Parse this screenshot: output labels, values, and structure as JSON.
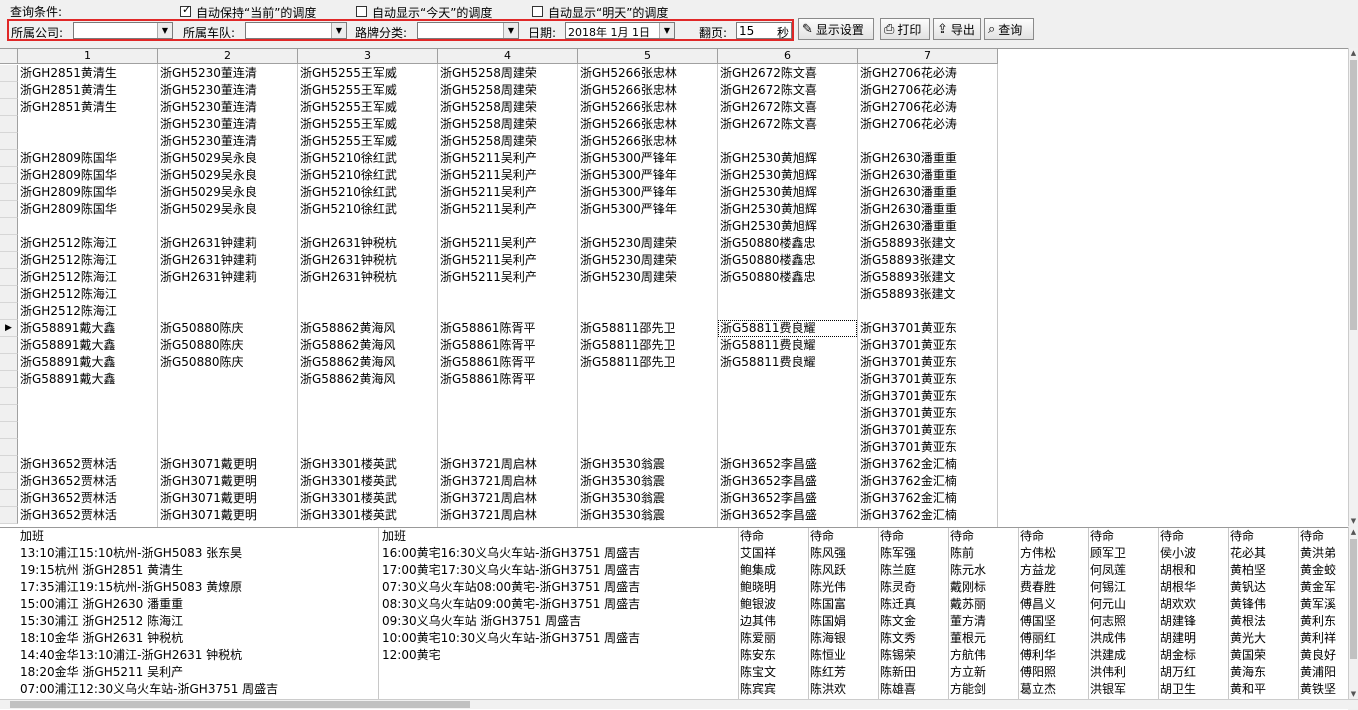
{
  "colors": {
    "highlight_border": "#e02828"
  },
  "topbar": {
    "label": "查询条件:",
    "checks": [
      {
        "label": "自动保持“当前”的调度",
        "checked": true
      },
      {
        "label": "自动显示“今天”的调度",
        "checked": false
      },
      {
        "label": "自动显示“明天”的调度",
        "checked": false
      }
    ]
  },
  "filters": {
    "company_label": "所属公司:",
    "company_value": "",
    "fleet_label": "所属车队:",
    "fleet_value": "",
    "route_label": "路牌分类:",
    "route_value": "",
    "date_label": "日期:",
    "date_value": "2018年  1月  1日",
    "page_label": "翻页:",
    "page_value": "15",
    "page_unit": "秒"
  },
  "toolbar": {
    "display_settings": "显示设置",
    "print": "打印",
    "export": "导出",
    "query": "查询",
    "icons": [
      "pencil-icon",
      "printer-icon",
      "export-icon",
      "magnifier-icon"
    ]
  },
  "grid": {
    "columns": [
      "1",
      "2",
      "3",
      "4",
      "5",
      "6",
      "7"
    ],
    "current_row": 15,
    "rows": [
      [
        "浙GH2851黄清生",
        "浙GH5230董连清",
        "浙GH5255王军威",
        "浙GH5258周建荣",
        "浙GH5266张忠林",
        "浙GH2672陈文喜",
        "浙GH2706花必涛"
      ],
      [
        "浙GH2851黄清生",
        "浙GH5230董连清",
        "浙GH5255王军威",
        "浙GH5258周建荣",
        "浙GH5266张忠林",
        "浙GH2672陈文喜",
        "浙GH2706花必涛"
      ],
      [
        "浙GH2851黄清生",
        "浙GH5230董连清",
        "浙GH5255王军威",
        "浙GH5258周建荣",
        "浙GH5266张忠林",
        "浙GH2672陈文喜",
        "浙GH2706花必涛"
      ],
      [
        "",
        "浙GH5230董连清",
        "浙GH5255王军威",
        "浙GH5258周建荣",
        "浙GH5266张忠林",
        "浙GH2672陈文喜",
        "浙GH2706花必涛"
      ],
      [
        "",
        "浙GH5230董连清",
        "浙GH5255王军威",
        "浙GH5258周建荣",
        "浙GH5266张忠林",
        "",
        ""
      ],
      [
        "浙GH2809陈国华",
        "浙GH5029吴永良",
        "浙GH5210徐红武",
        "浙GH5211吴利产",
        "浙GH5300严锋年",
        "浙GH2530黄旭辉",
        "浙GH2630潘重重"
      ],
      [
        "浙GH2809陈国华",
        "浙GH5029吴永良",
        "浙GH5210徐红武",
        "浙GH5211吴利产",
        "浙GH5300严锋年",
        "浙GH2530黄旭辉",
        "浙GH2630潘重重"
      ],
      [
        "浙GH2809陈国华",
        "浙GH5029吴永良",
        "浙GH5210徐红武",
        "浙GH5211吴利产",
        "浙GH5300严锋年",
        "浙GH2530黄旭辉",
        "浙GH2630潘重重"
      ],
      [
        "浙GH2809陈国华",
        "浙GH5029吴永良",
        "浙GH5210徐红武",
        "浙GH5211吴利产",
        "浙GH5300严锋年",
        "浙GH2530黄旭辉",
        "浙GH2630潘重重"
      ],
      [
        "",
        "",
        "",
        "",
        "",
        "浙GH2530黄旭辉",
        "浙GH2630潘重重"
      ],
      [
        "浙GH2512陈海江",
        "浙GH2631钟建莉",
        "浙GH2631钟税杭",
        "浙GH5211吴利产",
        "浙GH5230周建荣",
        "浙G50880楼鑫忠",
        "浙G58893张建文"
      ],
      [
        "浙GH2512陈海江",
        "浙GH2631钟建莉",
        "浙GH2631钟税杭",
        "浙GH5211吴利产",
        "浙GH5230周建荣",
        "浙G50880楼鑫忠",
        "浙G58893张建文"
      ],
      [
        "浙GH2512陈海江",
        "浙GH2631钟建莉",
        "浙GH2631钟税杭",
        "浙GH5211吴利产",
        "浙GH5230周建荣",
        "浙G50880楼鑫忠",
        "浙G58893张建文"
      ],
      [
        "浙GH2512陈海江",
        "",
        "",
        "",
        "",
        "",
        "浙G58893张建文"
      ],
      [
        "浙GH2512陈海江",
        "",
        "",
        "",
        "",
        "",
        ""
      ],
      [
        "浙G58891戴大鑫",
        "浙G50880陈庆",
        "浙G58862黄海风",
        "浙G58861陈胥平",
        "浙G58811邵先卫",
        "浙G58811费良耀",
        "浙GH3701黄亚东"
      ],
      [
        "浙G58891戴大鑫",
        "浙G50880陈庆",
        "浙G58862黄海风",
        "浙G58861陈胥平",
        "浙G58811邵先卫",
        "浙G58811费良耀",
        "浙GH3701黄亚东"
      ],
      [
        "浙G58891戴大鑫",
        "浙G50880陈庆",
        "浙G58862黄海风",
        "浙G58861陈胥平",
        "浙G58811邵先卫",
        "浙G58811费良耀",
        "浙GH3701黄亚东"
      ],
      [
        "浙G58891戴大鑫",
        "",
        "浙G58862黄海风",
        "浙G58861陈胥平",
        "",
        "",
        "浙GH3701黄亚东"
      ],
      [
        "",
        "",
        "",
        "",
        "",
        "",
        "浙GH3701黄亚东"
      ],
      [
        "",
        "",
        "",
        "",
        "",
        "",
        "浙GH3701黄亚东"
      ],
      [
        "",
        "",
        "",
        "",
        "",
        "",
        "浙GH3701黄亚东"
      ],
      [
        "",
        "",
        "",
        "",
        "",
        "",
        "浙GH3701黄亚东"
      ],
      [
        "浙GH3652贾林活",
        "浙GH3071戴更明",
        "浙GH3301楼英武",
        "浙GH3721周启林",
        "浙GH3530翁震",
        "浙GH3652李昌盛",
        "浙GH3762金汇楠"
      ],
      [
        "浙GH3652贾林活",
        "浙GH3071戴更明",
        "浙GH3301楼英武",
        "浙GH3721周启林",
        "浙GH3530翁震",
        "浙GH3652李昌盛",
        "浙GH3762金汇楠"
      ],
      [
        "浙GH3652贾林活",
        "浙GH3071戴更明",
        "浙GH3301楼英武",
        "浙GH3721周启林",
        "浙GH3530翁震",
        "浙GH3652李昌盛",
        "浙GH3762金汇楠"
      ],
      [
        "浙GH3652贾林活",
        "浙GH3071戴更明",
        "浙GH3301楼英武",
        "浙GH3721周启林",
        "浙GH3530翁震",
        "浙GH3652李昌盛",
        "浙GH3762金汇楠"
      ]
    ]
  },
  "bottom": {
    "extra1_title": "加班",
    "extra1": [
      "13:10浦江15:10杭州-浙GH5083 张东昊",
      "19:15杭州 浙GH2851 黄清生",
      "17:35浦江19:15杭州-浙GH5083 黄燎原",
      "15:00浦江 浙GH2630 潘重重",
      "15:30浦江 浙GH2512 陈海江",
      "18:10金华 浙GH2631 钟税杭",
      "14:40金华13:10浦江-浙GH2631 钟税杭",
      "18:20金华 浙GH5211 吴利产",
      "07:00浦江12:30义乌火车站-浙GH3751 周盛吉"
    ],
    "extra2_title": "加班",
    "extra2": [
      "16:00黄宅16:30义乌火车站-浙GH3751 周盛吉",
      "17:00黄宅17:30义乌火车站-浙GH3751 周盛吉",
      "07:30义乌火车站08:00黄宅-浙GH3751 周盛吉",
      "08:30义乌火车站09:00黄宅-浙GH3751 周盛吉",
      "09:30义乌火车站 浙GH3751 周盛吉",
      "10:00黄宅10:30义乌火车站-浙GH3751 周盛吉",
      "12:00黄宅"
    ],
    "standby": [
      {
        "title": "待命",
        "names": [
          "艾国祥",
          "鲍集成",
          "鲍晓明",
          "鲍银波",
          "边其伟",
          "陈爱丽",
          "陈安东",
          "陈宝文",
          "陈宾宾"
        ]
      },
      {
        "title": "待命",
        "names": [
          "陈风强",
          "陈风跃",
          "陈光伟",
          "陈国富",
          "陈国娟",
          "陈海银",
          "陈恒业",
          "陈红芳",
          "陈洪欢"
        ]
      },
      {
        "title": "待命",
        "names": [
          "陈军强",
          "陈兰庭",
          "陈灵奇",
          "陈迁真",
          "陈文金",
          "陈文秀",
          "陈锡荣",
          "陈新田",
          "陈雄喜"
        ]
      },
      {
        "title": "待命",
        "names": [
          "陈前",
          "陈元水",
          "戴刚标",
          "戴苏丽",
          "董方清",
          "董根元",
          "方航伟",
          "方立新",
          "方能剑"
        ]
      },
      {
        "title": "待命",
        "names": [
          "方伟松",
          "方益龙",
          "费春胜",
          "傅昌义",
          "傅国坚",
          "傅丽红",
          "傅利华",
          "傅阳照",
          "葛立杰"
        ]
      },
      {
        "title": "待命",
        "names": [
          "顾军卫",
          "何凤莲",
          "何锡江",
          "何元山",
          "何志照",
          "洪成伟",
          "洪建成",
          "洪伟利",
          "洪银军"
        ]
      },
      {
        "title": "待命",
        "names": [
          "侯小波",
          "胡根和",
          "胡根华",
          "胡欢欢",
          "胡建锋",
          "胡建明",
          "胡金标",
          "胡万红",
          "胡卫生"
        ]
      },
      {
        "title": "待命",
        "names": [
          "花必其",
          "黄柏坚",
          "黄钒达",
          "黄锋伟",
          "黄根法",
          "黄光大",
          "黄国荣",
          "黄海东",
          "黄和平"
        ]
      },
      {
        "title": "待命",
        "names": [
          "黄洪弟",
          "黄金蛟",
          "黄金军",
          "黄军溪",
          "黄利东",
          "黄利祥",
          "黄良好",
          "黄浦阳",
          "黄铁坚"
        ]
      }
    ]
  }
}
